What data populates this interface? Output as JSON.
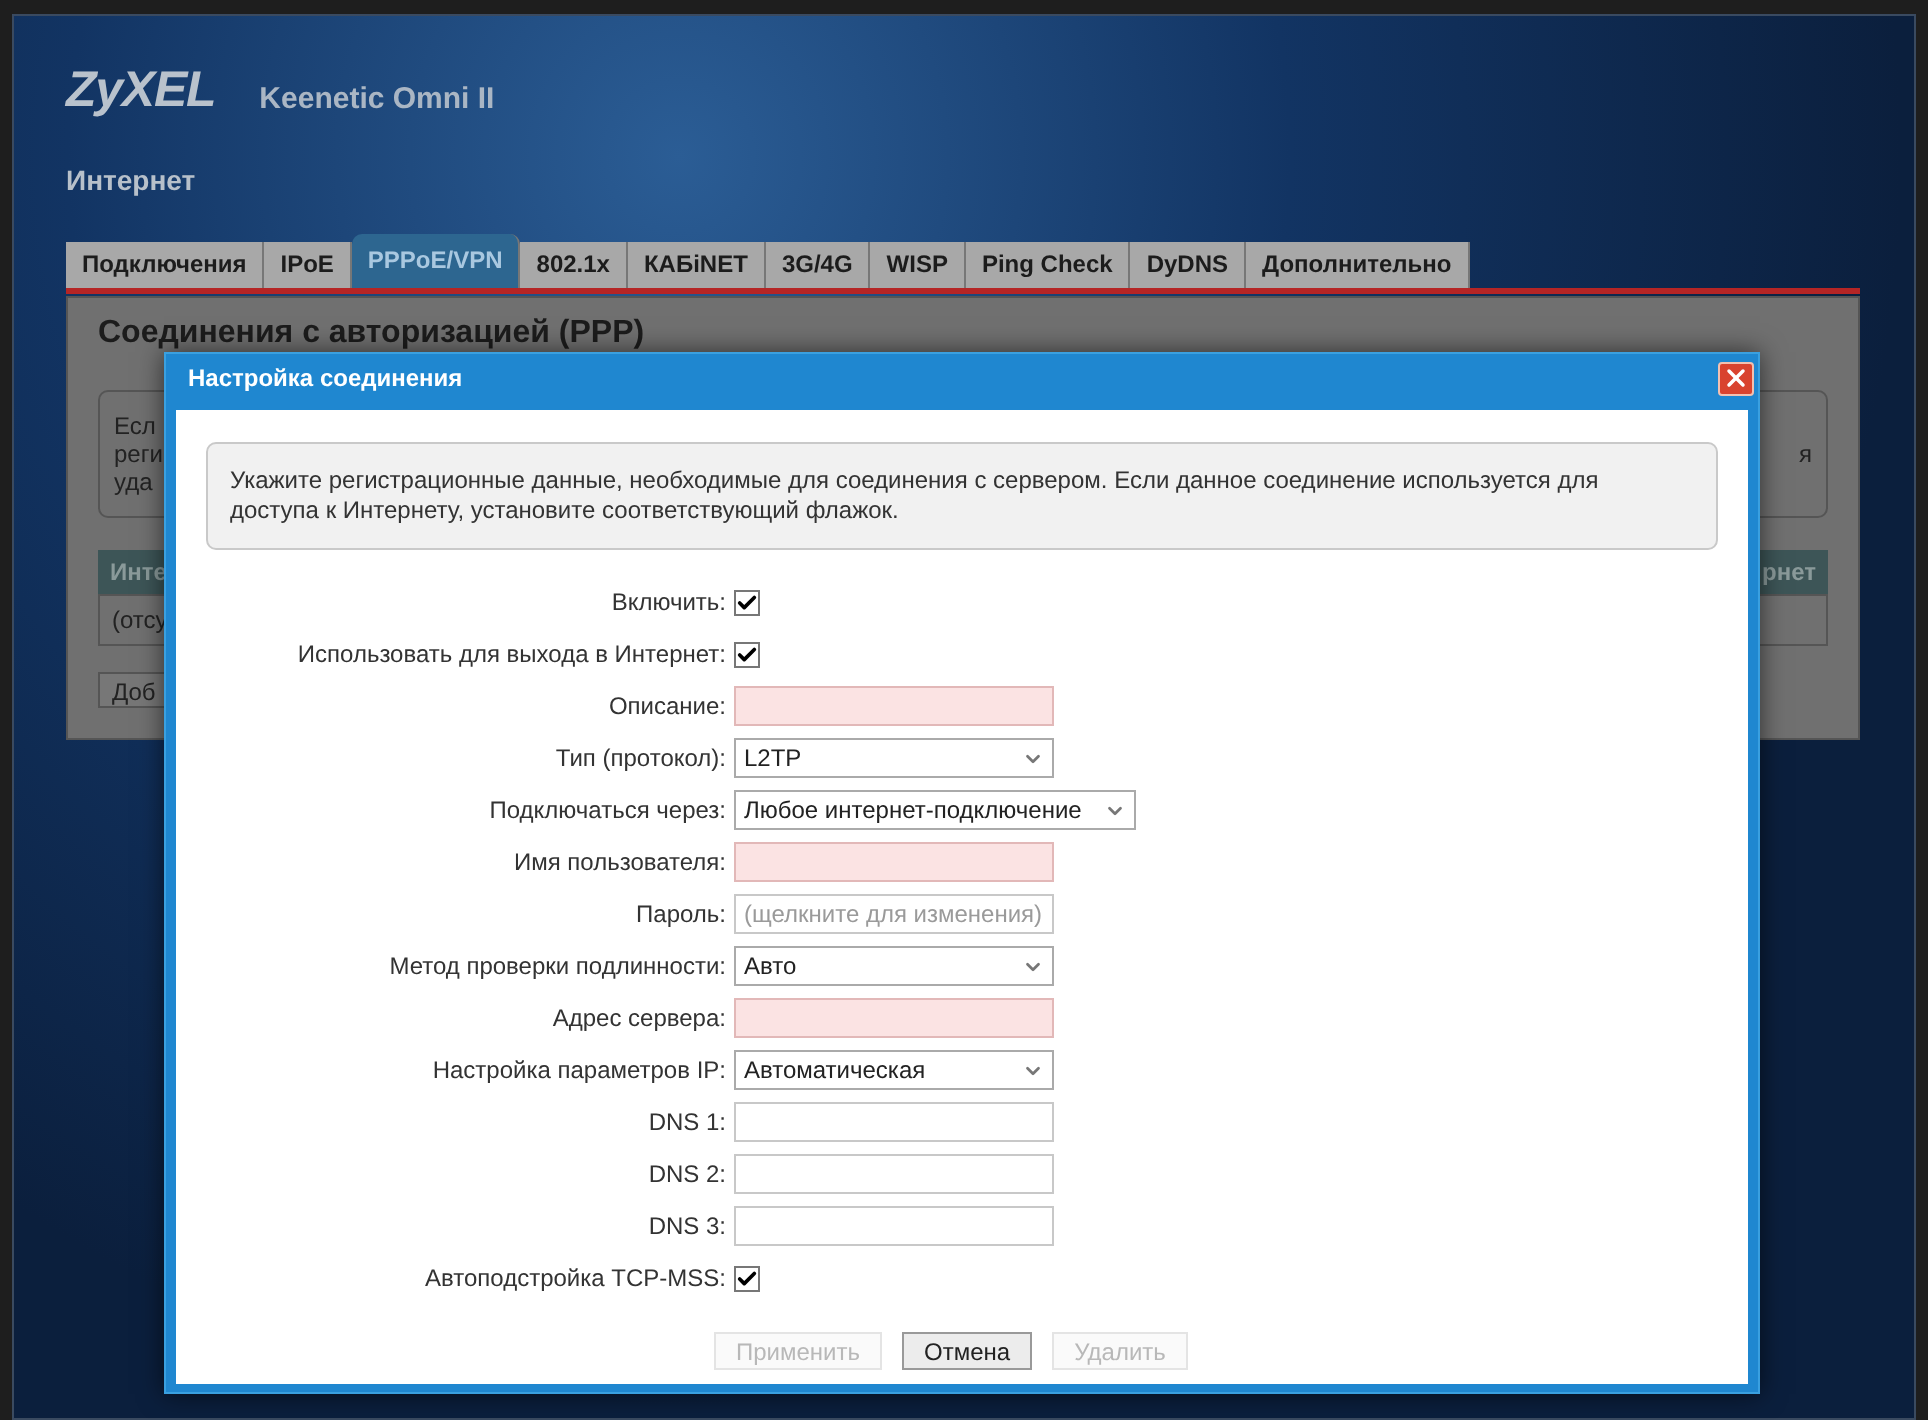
{
  "header": {
    "logo": "ZyXEL",
    "model": "Keenetic Omni II",
    "page_title": "Интернет"
  },
  "tabs": [
    {
      "label": "Подключения",
      "selected": false
    },
    {
      "label": "IPoE",
      "selected": false
    },
    {
      "label": "PPPoE/VPN",
      "selected": true
    },
    {
      "label": "802.1x",
      "selected": false
    },
    {
      "label": "КАБiNET",
      "selected": false
    },
    {
      "label": "3G/4G",
      "selected": false
    },
    {
      "label": "WISP",
      "selected": false
    },
    {
      "label": "Ping Check",
      "selected": false
    },
    {
      "label": "DyDNS",
      "selected": false
    },
    {
      "label": "Дополнительно",
      "selected": false
    }
  ],
  "panel": {
    "title": "Соединения с авторизацией (PPP)",
    "info_left": [
      "Есл",
      "реги",
      "уда"
    ],
    "info_right": "я",
    "table_header_left": "Инте",
    "table_header_right": "рнет",
    "row_left": "(отсу",
    "button_left": "Доб"
  },
  "dialog": {
    "title": "Настройка соединения",
    "info": "Укажите регистрационные данные, необходимые для соединения с сервером. Если данное соединение используется для доступа к Интернету, установите соответствующий флажок.",
    "fields": [
      {
        "kind": "checkbox",
        "label": "Включить:",
        "checked": true
      },
      {
        "kind": "checkbox",
        "label": "Использовать для выхода в Интернет:",
        "checked": true
      },
      {
        "kind": "text",
        "label": "Описание:",
        "highlighted": true
      },
      {
        "kind": "select",
        "label": "Тип (протокол):",
        "value": "L2TP"
      },
      {
        "kind": "select",
        "label": "Подключаться через:",
        "value": "Любое интернет-подключение"
      },
      {
        "kind": "text",
        "label": "Имя пользователя:",
        "highlighted": true
      },
      {
        "kind": "text",
        "label": "Пароль:",
        "placeholder": "(щелкните для изменения)",
        "highlighted": false
      },
      {
        "kind": "select",
        "label": "Метод проверки подлинности:",
        "value": "Авто"
      },
      {
        "kind": "text",
        "label": "Адрес сервера:",
        "highlighted": true
      },
      {
        "kind": "select",
        "label": "Настройка параметров IP:",
        "value": "Автоматическая"
      },
      {
        "kind": "text",
        "label": "DNS 1:",
        "highlighted": false
      },
      {
        "kind": "text",
        "label": "DNS 2:",
        "highlighted": false
      },
      {
        "kind": "text",
        "label": "DNS 3:",
        "highlighted": false
      },
      {
        "kind": "checkbox",
        "label": "Автоподстройка TCP-MSS:",
        "checked": true
      }
    ],
    "buttons": [
      {
        "label": "Применить",
        "disabled": true
      },
      {
        "label": "Отмена",
        "disabled": false
      },
      {
        "label": "Удалить",
        "disabled": true
      }
    ]
  }
}
